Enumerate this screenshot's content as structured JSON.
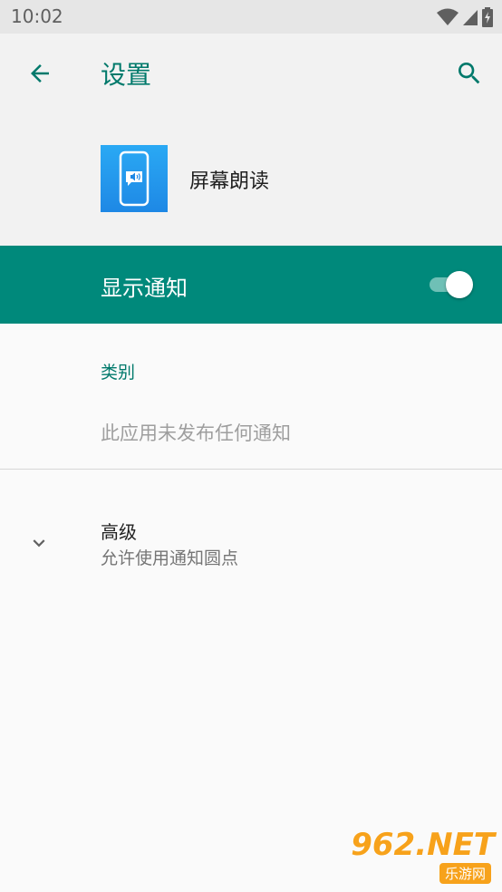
{
  "status_bar": {
    "time": "10:02"
  },
  "top_bar": {
    "title": "设置"
  },
  "app": {
    "name": "屏幕朗读"
  },
  "notification_toggle": {
    "label": "显示通知",
    "enabled": true
  },
  "categories": {
    "header": "类别",
    "empty_message": "此应用未发布任何通知"
  },
  "advanced": {
    "title": "高级",
    "subtitle": "允许使用通知圆点"
  },
  "watermark": {
    "logo": "962.NET",
    "sub": "乐游网"
  },
  "colors": {
    "accent": "#00796b",
    "toggle_row_bg": "#00897b",
    "app_icon": "#1e88e5"
  }
}
